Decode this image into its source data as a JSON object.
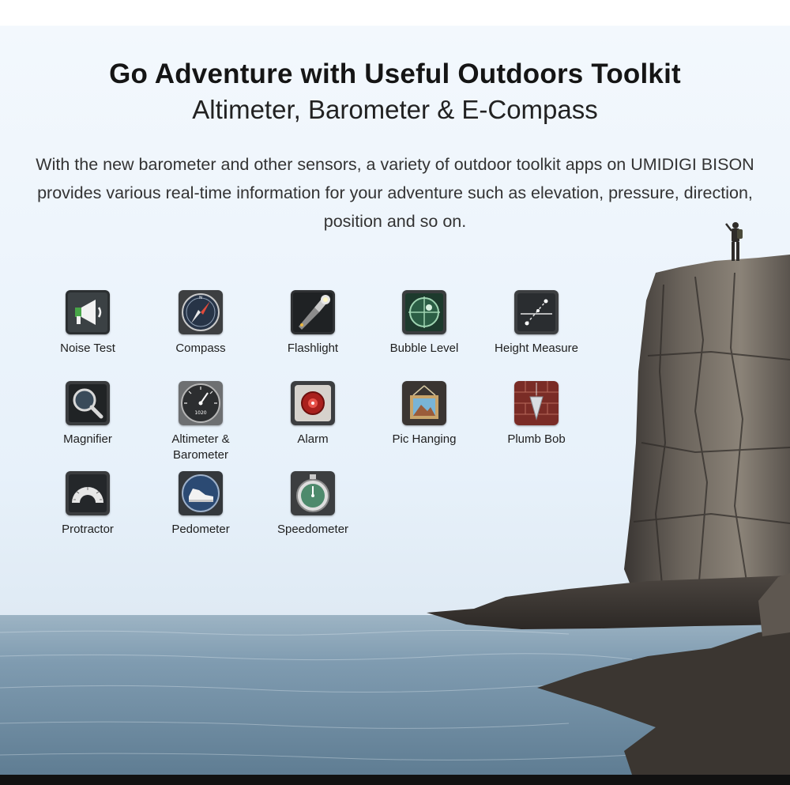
{
  "header": {
    "title": "Go Adventure with Useful Outdoors Toolkit",
    "subtitle": "Altimeter, Barometer & E-Compass",
    "description": "With the new barometer and other sensors, a variety of outdoor toolkit apps on UMIDIGI BISON provides various real-time information for your adventure such as elevation, pressure, direction, position and so on."
  },
  "tools": [
    {
      "label": "Noise Test",
      "icon": "megaphone-icon"
    },
    {
      "label": "Compass",
      "icon": "compass-icon"
    },
    {
      "label": "Flashlight",
      "icon": "flashlight-icon"
    },
    {
      "label": "Bubble Level",
      "icon": "bubble-level-icon"
    },
    {
      "label": "Height Measure",
      "icon": "height-measure-icon"
    },
    {
      "label": "Magnifier",
      "icon": "magnifier-icon"
    },
    {
      "label": "Altimeter &\nBarometer",
      "icon": "barometer-gauge-icon",
      "gauge_reading": "1020"
    },
    {
      "label": "Alarm",
      "icon": "alarm-icon"
    },
    {
      "label": "Pic Hanging",
      "icon": "picture-frame-icon"
    },
    {
      "label": "Plumb Bob",
      "icon": "plumb-bob-icon"
    },
    {
      "label": "Protractor",
      "icon": "protractor-icon"
    },
    {
      "label": "Pedometer",
      "icon": "shoe-icon"
    },
    {
      "label": "Speedometer",
      "icon": "stopwatch-icon"
    }
  ],
  "colors": {
    "sky": "#eef5fc",
    "sea": "#7a97ad",
    "rock": "#4a4541",
    "text": "#151515"
  }
}
